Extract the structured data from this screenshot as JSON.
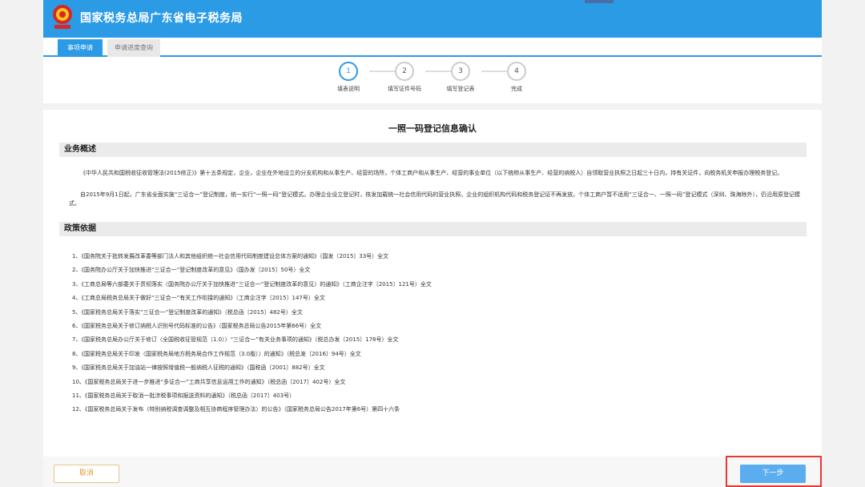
{
  "header": {
    "title": "国家税务总局广东省电子税务局"
  },
  "tabs": [
    {
      "label": "事项申请",
      "active": true
    },
    {
      "label": "申请进度查询",
      "active": false
    }
  ],
  "steps": [
    {
      "number": "1",
      "label": "填表说明",
      "active": true
    },
    {
      "number": "2",
      "label": "填写证件号码",
      "active": false
    },
    {
      "number": "3",
      "label": "填写登记表",
      "active": false
    },
    {
      "number": "4",
      "label": "完成",
      "active": false
    }
  ],
  "page": {
    "title": "一照一码登记信息确认",
    "overview_heading": "业务概述",
    "overview_p1": "《中华人民共和国税收征收管理法(2015修正)》第十五条规定，企业，企业在外地设立的分支机构和从事生产、经营的场所，个体工商户和从事生产、经营的事业单位（以下统称从事生产、经营的纳税人）自领取营业执照之日起三十日内，持有关证件，向税务机关申报办理税务登记。",
    "overview_p2": "自2015年9月1日起，广东省全面实施“三证合一”登记制度，统一实行“一照一码”登记模式。办理企业设立登记时，核发加载统一社会信用代码的营业执照，企业的组织机构代码和税务登记证不再发放。个体工商户暂不适用“三证合一、一照一码”登记模式（深圳、珠海除外），仍沿用原登记模式。",
    "policy_heading": "政策依据",
    "policies": [
      "1、《国务院关于批转发展改革委等部门法人和其他组织统一社会信用代码制度建设总体方案的通知》（国发〔2015〕33号）全文",
      "2、《国务院办公厅关于加快推进“三证合一”登记制度改革的意见》（国办发〔2015〕50号）全文",
      "3、《工商总局等六部委关于贯彻落实〈国务院办公厅关于加快推进“三证合一”登记制度改革的意见〉的通知》（工商企注字〔2015〕121号）全文",
      "4、《工商总局税务总局关于做好“三证合一”有关工作衔接的通知》（工商企注字〔2015〕147号）全文",
      "5、《国家税务总局关于落实“三证合一”登记制度改革的通知》（税总函〔2015〕482号）全文",
      "6、《国家税务总局关于修订纳税人识别号代码标准的公告》（国家税务总局公告2015年第66号）全文",
      "7、《国家税务总局办公厅关于修订〈全国税收征管规范（1.0）〉“三证合一”有关业务事项的通知》（税总办发〔2015〕178号）全文",
      "8、《国家税务总局关于印发〈国家税务局地方税务局合作工作规范（3.0版）〉的通知》（税总发〔2016〕94号）全文",
      "9、《国家税务总局关于加油站一律按照增值税一般纳税人征税的通知》（国税函〔2001〕882号）全文",
      "10、《国家税务总局关于进一步推进“多证合一”工商共享信息运用工作的通知》（税总函〔2017〕402号）全文",
      "11、《国家税务总局关于取消一批涉税事项和报送资料的通知》（税总函〔2017〕403号）",
      "12、《国家税务总局关于发布〈特别纳税调查调整及相互协商程序管理办法〉的公告》（国家税务总局公告2017年第6号）第四十六条"
    ]
  },
  "footer": {
    "cancel_label": "取消",
    "next_label": "下一步"
  },
  "colors": {
    "brand": "#2b9be6",
    "next_button": "#5aaef0",
    "cancel_text": "#e09a3a",
    "highlight": "#e53935"
  }
}
